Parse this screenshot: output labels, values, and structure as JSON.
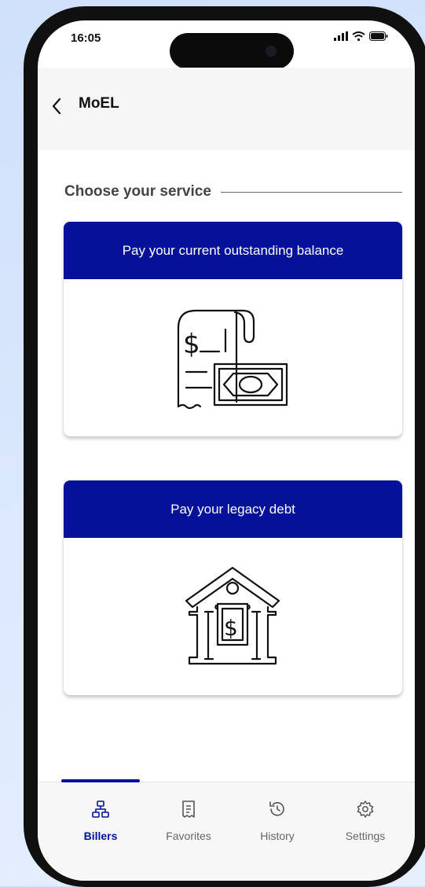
{
  "status_bar": {
    "time": "16:05"
  },
  "header": {
    "title": "MoEL"
  },
  "section": {
    "title": "Choose your service"
  },
  "cards": [
    {
      "label": "Pay your current outstanding balance",
      "icon": "receipt-money-icon"
    },
    {
      "label": "Pay your legacy debt",
      "icon": "bank-dollar-icon"
    }
  ],
  "tabbar": {
    "active": "Billers",
    "tabs": [
      {
        "label": "Billers",
        "icon": "sitemap-icon"
      },
      {
        "label": "Favorites",
        "icon": "receipt-icon"
      },
      {
        "label": "History",
        "icon": "history-icon"
      },
      {
        "label": "Settings",
        "icon": "gear-icon"
      }
    ]
  },
  "colors": {
    "brand_blue": "#051199",
    "header_bg": "#f6f6f6"
  }
}
